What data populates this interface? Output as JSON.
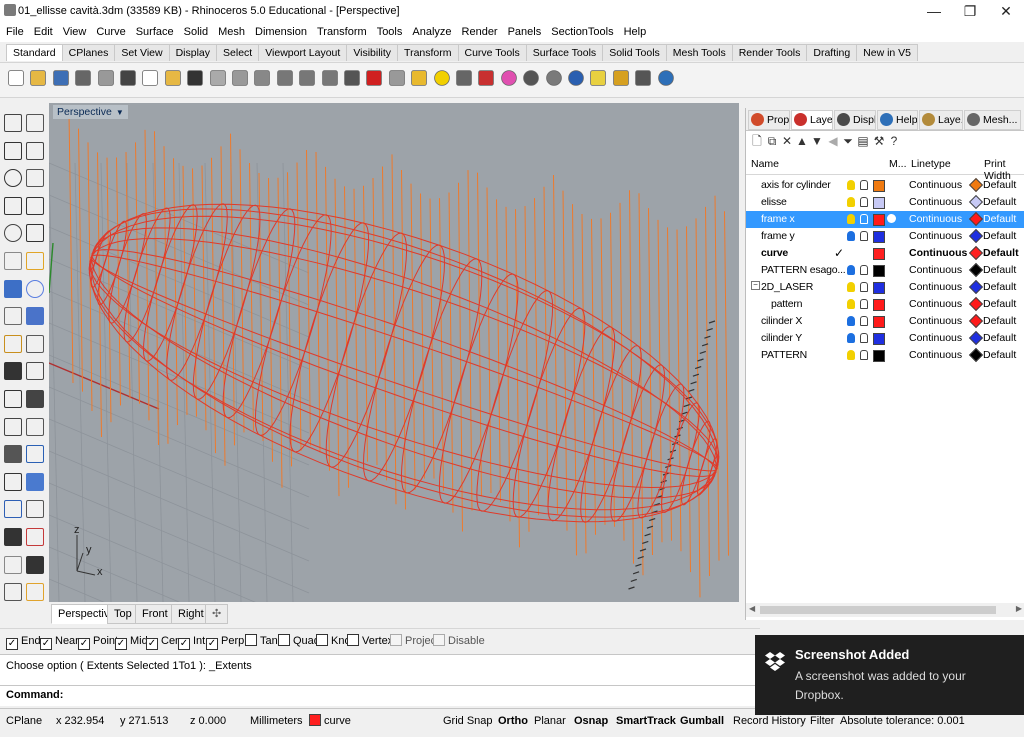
{
  "window": {
    "title": "01_ellisse cavità.3dm (33589 KB) - Rhinoceros 5.0 Educational - [Perspective]",
    "minimize": "—",
    "maximize": "❐",
    "close": "✕"
  },
  "menu": [
    "File",
    "Edit",
    "View",
    "Curve",
    "Surface",
    "Solid",
    "Mesh",
    "Dimension",
    "Transform",
    "Tools",
    "Analyze",
    "Render",
    "Panels",
    "SectionTools",
    "Help"
  ],
  "toolbar_tabs": [
    "Standard",
    "CPlanes",
    "Set View",
    "Display",
    "Select",
    "Viewport Layout",
    "Visibility",
    "Transform",
    "Curve Tools",
    "Surface Tools",
    "Solid Tools",
    "Mesh Tools",
    "Render Tools",
    "Drafting",
    "New in V5"
  ],
  "viewport": {
    "label": "Perspective",
    "axis_x": "x",
    "axis_y": "y",
    "axis_z": "z"
  },
  "viewport_tabs": [
    "Perspective",
    "Top",
    "Front",
    "Right",
    "✣"
  ],
  "panel_tabs": [
    {
      "label": "Prop...",
      "icon": "properties-icon",
      "color": "#d14b2a"
    },
    {
      "label": "Laye...",
      "icon": "layers-icon",
      "color": "#c9302c"
    },
    {
      "label": "Displ...",
      "icon": "display-icon",
      "color": "#4a4a4a"
    },
    {
      "label": "Help",
      "icon": "help-icon",
      "color": "#2d6fb8"
    },
    {
      "label": "Laye...",
      "icon": "layer-state-icon",
      "color": "#b38b3b"
    },
    {
      "label": "Mesh...",
      "icon": "mesh-icon",
      "color": "#666666"
    }
  ],
  "layer_columns": {
    "name": "Name",
    "material": "M...",
    "linetype": "Linetype",
    "printwidth": "Print Width"
  },
  "layers": [
    {
      "name": "axis for cylinder",
      "color": "#f07a10",
      "linetype": "Continuous",
      "printwidth": "Default",
      "bulb": "#f2d000",
      "selected": false,
      "current": false
    },
    {
      "name": "elisse",
      "color": "#c7c9f5",
      "linetype": "Continuous",
      "printwidth": "Default",
      "bulb": "#f2d000",
      "selected": false,
      "current": false
    },
    {
      "name": "frame x",
      "color": "#ff1a1a",
      "linetype": "Continuous",
      "printwidth": "Default",
      "bulb": "#f2d000",
      "selected": true,
      "current": false
    },
    {
      "name": "frame y",
      "color": "#1f2fe0",
      "linetype": "Continuous",
      "printwidth": "Default",
      "bulb": "#1c6fe0",
      "selected": false,
      "current": false
    },
    {
      "name": "curve",
      "color": "#ff2020",
      "linetype": "Continuous",
      "printwidth": "Default",
      "bulb": "",
      "selected": false,
      "current": true
    },
    {
      "name": "PATTERN esago...",
      "color": "#000000",
      "linetype": "Continuous",
      "printwidth": "Default",
      "bulb": "#1c6fe0",
      "selected": false,
      "current": false
    },
    {
      "name": "2D_LASER",
      "color": "#1f2fe0",
      "linetype": "Continuous",
      "printwidth": "Default",
      "bulb": "#f2d000",
      "selected": false,
      "current": false,
      "expander": "−"
    },
    {
      "name": "pattern",
      "color": "#ff1a1a",
      "linetype": "Continuous",
      "printwidth": "Default",
      "bulb": "#f2d000",
      "selected": false,
      "current": false,
      "indent": true
    },
    {
      "name": "cilinder X",
      "color": "#ff1a1a",
      "linetype": "Continuous",
      "printwidth": "Default",
      "bulb": "#1c6fe0",
      "selected": false,
      "current": false
    },
    {
      "name": "cilinder Y",
      "color": "#1f2fe0",
      "linetype": "Continuous",
      "printwidth": "Default",
      "bulb": "#1c6fe0",
      "selected": false,
      "current": false
    },
    {
      "name": "PATTERN",
      "color": "#000000",
      "linetype": "Continuous",
      "printwidth": "Default",
      "bulb": "#f2d000",
      "selected": false,
      "current": false
    }
  ],
  "osnaps": [
    {
      "label": "End",
      "checked": true
    },
    {
      "label": "Near",
      "checked": true
    },
    {
      "label": "Point",
      "checked": true
    },
    {
      "label": "Mid",
      "checked": true
    },
    {
      "label": "Cen",
      "checked": true
    },
    {
      "label": "Int",
      "checked": true
    },
    {
      "label": "Perp",
      "checked": true
    },
    {
      "label": "Tan",
      "checked": false
    },
    {
      "label": "Quad",
      "checked": false
    },
    {
      "label": "Knot",
      "checked": false
    },
    {
      "label": "Vertex",
      "checked": false
    },
    {
      "label": "Project",
      "checked": false,
      "disabled": true
    },
    {
      "label": "Disable",
      "checked": false,
      "disabled": true
    }
  ],
  "command": {
    "history": "Choose option ( Extents  Selected  1To1 ): _Extents",
    "prompt": "Command:"
  },
  "status": {
    "cplane": "CPlane",
    "x": "x 232.954",
    "y": "y 271.513",
    "z": "z 0.000",
    "units": "Millimeters",
    "layer": "curve",
    "layer_color": "#ff2020",
    "grid_snap": "Grid Snap",
    "ortho": "Ortho",
    "planar": "Planar",
    "osnap": "Osnap",
    "smarttrack": "SmartTrack",
    "gumball": "Gumball",
    "record_history": "Record History",
    "filter": "Filter",
    "tolerance": "Absolute tolerance: 0.001"
  },
  "notification": {
    "title": "Screenshot Added",
    "body": "A screenshot was added to your Dropbox."
  },
  "toolbar_icons": [
    {
      "name": "new-file-icon",
      "color": "#ffffff"
    },
    {
      "name": "open-folder-icon",
      "color": "#e6b844"
    },
    {
      "name": "save-icon",
      "color": "#3e6fb5"
    },
    {
      "name": "print-icon",
      "color": "#666666"
    },
    {
      "name": "import-icon",
      "color": "#999999"
    },
    {
      "name": "cut-icon",
      "color": "#444444"
    },
    {
      "name": "copy-icon",
      "color": "#ffffff"
    },
    {
      "name": "paste-icon",
      "color": "#e6b844"
    },
    {
      "name": "undo-icon",
      "color": "#333333"
    },
    {
      "name": "pan-icon",
      "color": "#aaaaaa"
    },
    {
      "name": "rotate-view-icon",
      "color": "#999999"
    },
    {
      "name": "zoom-icon",
      "color": "#888888"
    },
    {
      "name": "zoom-extents-icon",
      "color": "#777777"
    },
    {
      "name": "zoom-window-icon",
      "color": "#777777"
    },
    {
      "name": "zoom-selected-icon",
      "color": "#777777"
    },
    {
      "name": "four-views-icon",
      "color": "#555555"
    },
    {
      "name": "car-icon",
      "color": "#d02020"
    },
    {
      "name": "select-all-icon",
      "color": "#999999"
    },
    {
      "name": "select-points-icon",
      "color": "#e8b92e"
    },
    {
      "name": "light-icon",
      "color": "#f2d000"
    },
    {
      "name": "lock-icon",
      "color": "#666666"
    },
    {
      "name": "layer-icon",
      "color": "#c83030"
    },
    {
      "name": "color-wheel-icon",
      "color": "#e050b0"
    },
    {
      "name": "material-sphere-icon",
      "color": "#555555"
    },
    {
      "name": "render-sphere-icon",
      "color": "#7a7a7a"
    },
    {
      "name": "rendered-sphere-icon",
      "color": "#2a5fb0"
    },
    {
      "name": "brush-icon",
      "color": "#e8d040"
    },
    {
      "name": "options-gear-icon",
      "color": "#d6a020"
    },
    {
      "name": "snap-icon",
      "color": "#555555"
    },
    {
      "name": "help-circle-icon",
      "color": "#2d6fb8"
    }
  ]
}
